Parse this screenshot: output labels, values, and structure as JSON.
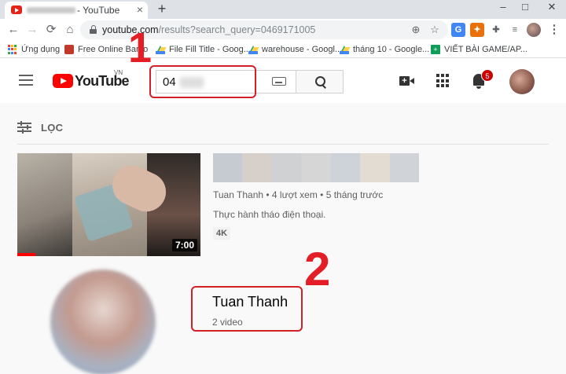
{
  "browser": {
    "tab": {
      "title": "- YouTube",
      "close": "×",
      "new_tab": "+"
    },
    "window_controls": [
      "–",
      "□",
      "✕"
    ],
    "nav": {
      "back": "←",
      "forward": "→",
      "reload": "⟳",
      "home": "⌂"
    },
    "address": {
      "host": "youtube.com",
      "path": "/results?search_query=0469171005"
    },
    "omnibox_icons": [
      "zoom-icon",
      "star-icon"
    ],
    "extensions": [
      {
        "name": "google-translate-icon",
        "label": "G",
        "color": "#4285f4"
      },
      {
        "name": "fire-extension-icon",
        "label": "✦",
        "color": "#e8710a"
      },
      {
        "name": "puzzle-icon",
        "label": "✚",
        "color": "#5f6368"
      },
      {
        "name": "playlist-icon",
        "label": "≡",
        "color": "#5f6368"
      }
    ],
    "menu": "⋮",
    "bookmarks": [
      {
        "label": "Ứng dụng",
        "icon": "apps-grid-icon"
      },
      {
        "label": "Free Online Barco",
        "icon": "barcode-icon"
      },
      {
        "label": "File Fill Title - Goog...",
        "icon": "drive-icon"
      },
      {
        "label": "warehouse - Googl...",
        "icon": "drive-icon"
      },
      {
        "label": "tháng 10 - Google...",
        "icon": "drive-icon"
      },
      {
        "label": "VIẾT BÀI GAME/AP...",
        "icon": "sheets-icon"
      }
    ]
  },
  "youtube": {
    "logo_text": "YouTube",
    "country": "VN",
    "search": {
      "value": "04"
    },
    "notifications_count": "5",
    "filter_label": "LỌC",
    "video": {
      "duration": "7:00",
      "meta": "Tuan Thanh • 4 lượt xem • 5 tháng trước",
      "description": "Thực hành tháo điện thoại.",
      "badge": "4K",
      "progress": 0.1
    },
    "channel": {
      "name": "Tuan Thanh",
      "count": "2 video"
    }
  },
  "annotations": {
    "step1": "1",
    "step2": "2",
    "color": "#d32027"
  }
}
